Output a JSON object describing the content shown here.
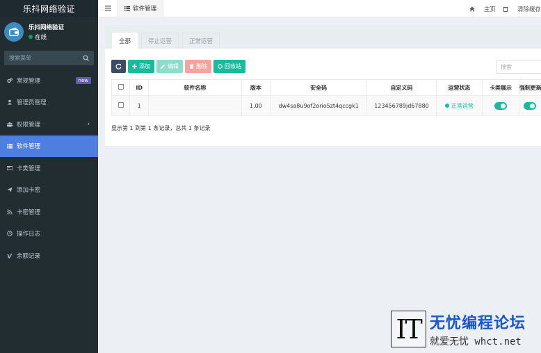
{
  "sidebar": {
    "brand": "乐抖网络验证",
    "user": {
      "name": "乐抖网络验证",
      "status": "在线"
    },
    "search_placeholder": "搜索菜单",
    "items": [
      {
        "label": "常规管理",
        "badge": "new"
      },
      {
        "label": "管理员管理"
      },
      {
        "label": "权限管理",
        "chevron": "‹"
      },
      {
        "label": "软件管理"
      },
      {
        "label": "卡类管理"
      },
      {
        "label": "添加卡密"
      },
      {
        "label": "卡密管理"
      },
      {
        "label": "操作日志"
      },
      {
        "label": "余额记录"
      }
    ]
  },
  "topbar": {
    "tab_label": "软件管理",
    "home_label": "主页",
    "clear_cache_label": "清除缓存"
  },
  "panel": {
    "tabs": [
      "全部",
      "停止运营",
      "正常运营"
    ],
    "toolbar": {
      "add": "添加",
      "edit": "编辑",
      "delete": "删除",
      "recycle": "回收站"
    },
    "search_placeholder": "搜索",
    "columns": [
      "ID",
      "软件名称",
      "版本",
      "安全码",
      "自定义码",
      "运营状态",
      "卡类展示",
      "强制更新"
    ],
    "rows": [
      {
        "id": "1",
        "name": "",
        "version": "1.00",
        "security_code": "dw4sa8u9of2orio5zt4qccgk1",
        "custom_code": "123456789jd67880",
        "status": "正常运营"
      }
    ],
    "pager": "显示第 1 到第 1 条记录，总共 1 条记录"
  },
  "watermark": {
    "logo": "IT",
    "title": "无忧编程论坛",
    "subtitle": "就爱无忧 whct.net"
  },
  "colors": {
    "sidebar_bg": "#222d32",
    "active_menu": "#4d7ee0",
    "primary_green": "#18bc9c"
  }
}
